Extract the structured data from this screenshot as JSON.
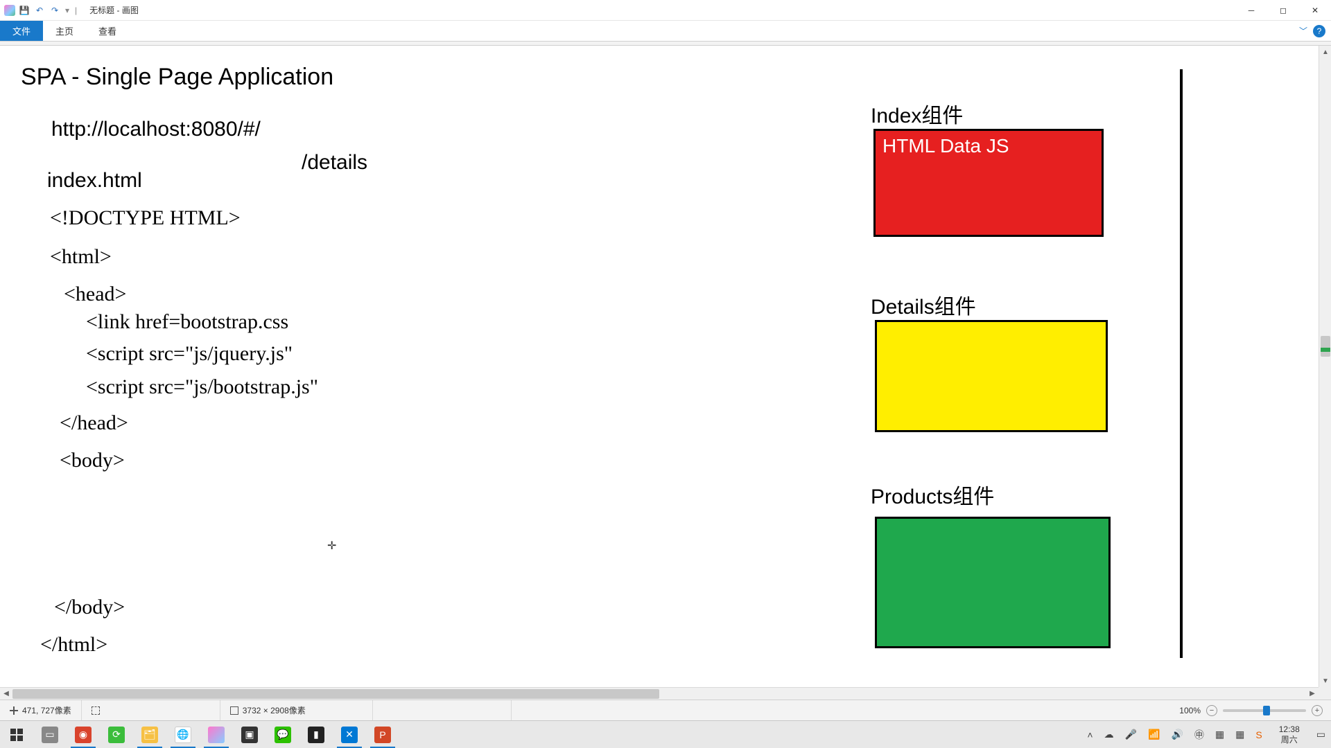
{
  "titlebar": {
    "doc": "无标题",
    "app": "画图"
  },
  "ribbon": {
    "file": "文件",
    "home": "主页",
    "view": "查看"
  },
  "drawing": {
    "title": "SPA - Single Page Application",
    "url": "http://localhost:8080/#/",
    "route": "/details",
    "file": "index.html",
    "code1": "<!DOCTYPE HTML>",
    "code2": "<html>",
    "code3": "<head>",
    "code4": "<link href=bootstrap.css",
    "code5": "<script src=\"js/jquery.js\"",
    "code6": "<script src=\"js/bootstrap.js\"",
    "code7": "</head>",
    "code8": "<body>",
    "code9": "</body>",
    "code10": "</html>",
    "cursor": "✛",
    "comp1_title": "Index组件",
    "comp1_text": "HTML Data JS",
    "comp2_title": "Details组件",
    "comp3_title": "Products组件"
  },
  "status": {
    "coords": "471, 727像素",
    "size": "3732 × 2908像素",
    "zoom": "100%"
  },
  "clock": {
    "time": "12:38",
    "date": "周六"
  }
}
